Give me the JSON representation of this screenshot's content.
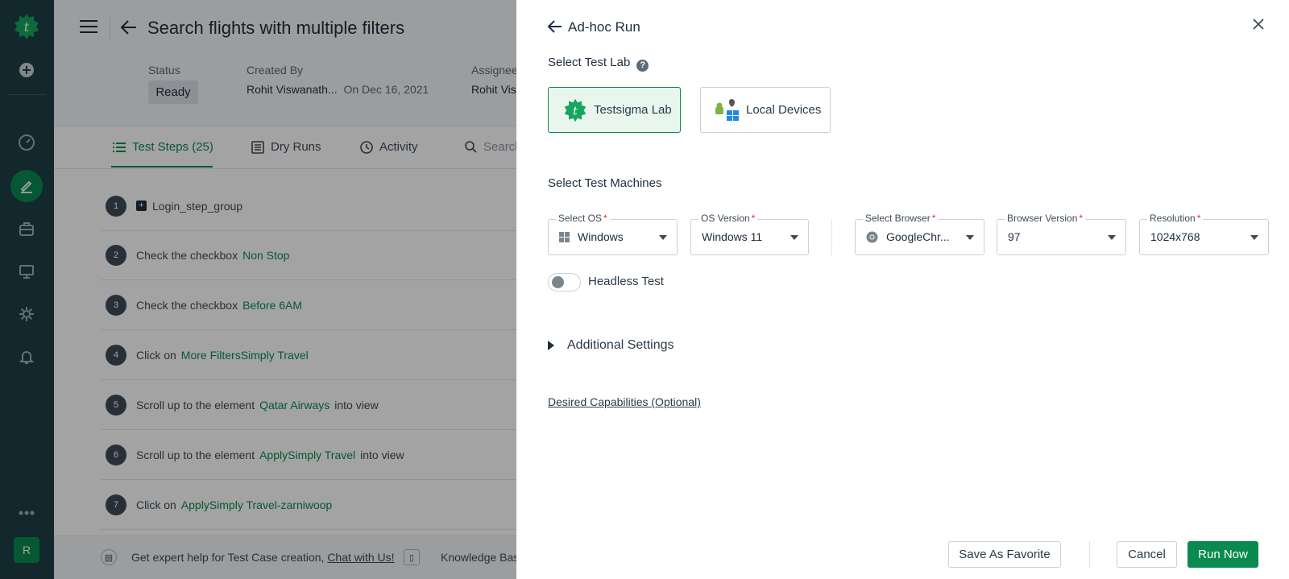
{
  "rail": {
    "avatar_initial": "R",
    "icons": [
      "testsigma-logo-icon",
      "plus-icon",
      "dashboard-icon",
      "edit-icon",
      "briefcase-icon",
      "monitor-icon",
      "settings-icon",
      "bell-icon",
      "more-icon"
    ]
  },
  "page": {
    "title": "Search flights with multiple filters",
    "status_label": "Status",
    "status_value": "Ready",
    "created_by_label": "Created By",
    "created_by_value": "Rohit Viswanath...",
    "created_on": "On Dec 16, 2021",
    "assignee_label": "Assignee",
    "assignee_value": "Rohit Vis",
    "tabs": [
      {
        "label": "Test Steps (25)",
        "active": true
      },
      {
        "label": "Dry Runs",
        "active": false
      },
      {
        "label": "Activity",
        "active": false
      },
      {
        "label": "Search",
        "active": false
      }
    ],
    "steps": [
      {
        "num": "1",
        "text": "Login_step_group",
        "green": "",
        "after": ""
      },
      {
        "num": "2",
        "text": "Check the checkbox",
        "green": "Non Stop",
        "after": ""
      },
      {
        "num": "3",
        "text": "Check the checkbox",
        "green": "Before 6AM",
        "after": ""
      },
      {
        "num": "4",
        "text": "Click on",
        "green": "More FiltersSimply Travel",
        "after": ""
      },
      {
        "num": "5",
        "text": "Scroll up to the element",
        "green": "Qatar Airways",
        "after": "into view"
      },
      {
        "num": "6",
        "text": "Scroll up to the element",
        "green": "ApplySimply Travel",
        "after": "into view"
      },
      {
        "num": "7",
        "text": "Click on",
        "green": "ApplySimply Travel-zarniwoop",
        "after": ""
      }
    ],
    "footer": {
      "help_text": "Get expert help for Test Case creation,",
      "chat_link": "Chat with Us!",
      "kb_text": "Knowledge Bas"
    }
  },
  "drawer": {
    "title": "Ad-hoc Run",
    "lab_section": "Select Test Lab",
    "lab_options": [
      {
        "label": "Testsigma Lab",
        "selected": true
      },
      {
        "label": "Local Devices",
        "selected": false
      }
    ],
    "machines_section": "Select Test Machines",
    "selects": {
      "os": {
        "label": "Select OS",
        "value": "Windows"
      },
      "os_version": {
        "label": "OS Version",
        "value": "Windows 11"
      },
      "browser": {
        "label": "Select Browser",
        "value": "GoogleChr..."
      },
      "browser_version": {
        "label": "Browser Version",
        "value": "97"
      },
      "resolution": {
        "label": "Resolution",
        "value": "1024x768"
      }
    },
    "required_mark": "*",
    "headless": {
      "label": "Headless Test",
      "on": false
    },
    "additional_settings": "Additional Settings",
    "desired_capabilities": "Desired Capabilities (Optional)",
    "buttons": {
      "save_favorite": "Save As Favorite",
      "cancel": "Cancel",
      "run_now": "Run Now"
    }
  },
  "colors": {
    "brand_green": "#0a8a4f",
    "rail_bg": "#1d3f45",
    "required": "#e0303a"
  }
}
